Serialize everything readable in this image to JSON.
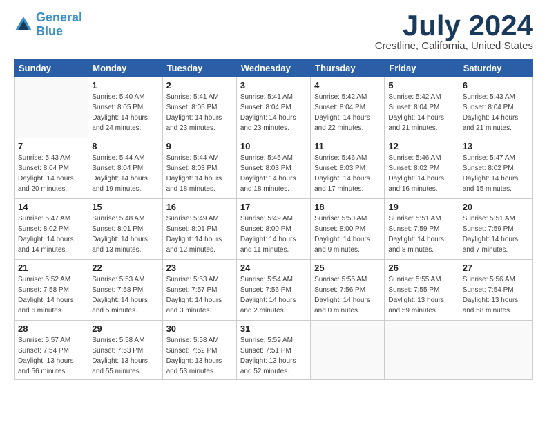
{
  "header": {
    "logo_line1": "General",
    "logo_line2": "Blue",
    "month": "July 2024",
    "location": "Crestline, California, United States"
  },
  "days_of_week": [
    "Sunday",
    "Monday",
    "Tuesday",
    "Wednesday",
    "Thursday",
    "Friday",
    "Saturday"
  ],
  "weeks": [
    [
      {
        "day": "",
        "info": ""
      },
      {
        "day": "1",
        "info": "Sunrise: 5:40 AM\nSunset: 8:05 PM\nDaylight: 14 hours\nand 24 minutes."
      },
      {
        "day": "2",
        "info": "Sunrise: 5:41 AM\nSunset: 8:05 PM\nDaylight: 14 hours\nand 23 minutes."
      },
      {
        "day": "3",
        "info": "Sunrise: 5:41 AM\nSunset: 8:04 PM\nDaylight: 14 hours\nand 23 minutes."
      },
      {
        "day": "4",
        "info": "Sunrise: 5:42 AM\nSunset: 8:04 PM\nDaylight: 14 hours\nand 22 minutes."
      },
      {
        "day": "5",
        "info": "Sunrise: 5:42 AM\nSunset: 8:04 PM\nDaylight: 14 hours\nand 21 minutes."
      },
      {
        "day": "6",
        "info": "Sunrise: 5:43 AM\nSunset: 8:04 PM\nDaylight: 14 hours\nand 21 minutes."
      }
    ],
    [
      {
        "day": "7",
        "info": "Sunrise: 5:43 AM\nSunset: 8:04 PM\nDaylight: 14 hours\nand 20 minutes."
      },
      {
        "day": "8",
        "info": "Sunrise: 5:44 AM\nSunset: 8:04 PM\nDaylight: 14 hours\nand 19 minutes."
      },
      {
        "day": "9",
        "info": "Sunrise: 5:44 AM\nSunset: 8:03 PM\nDaylight: 14 hours\nand 18 minutes."
      },
      {
        "day": "10",
        "info": "Sunrise: 5:45 AM\nSunset: 8:03 PM\nDaylight: 14 hours\nand 18 minutes."
      },
      {
        "day": "11",
        "info": "Sunrise: 5:46 AM\nSunset: 8:03 PM\nDaylight: 14 hours\nand 17 minutes."
      },
      {
        "day": "12",
        "info": "Sunrise: 5:46 AM\nSunset: 8:02 PM\nDaylight: 14 hours\nand 16 minutes."
      },
      {
        "day": "13",
        "info": "Sunrise: 5:47 AM\nSunset: 8:02 PM\nDaylight: 14 hours\nand 15 minutes."
      }
    ],
    [
      {
        "day": "14",
        "info": "Sunrise: 5:47 AM\nSunset: 8:02 PM\nDaylight: 14 hours\nand 14 minutes."
      },
      {
        "day": "15",
        "info": "Sunrise: 5:48 AM\nSunset: 8:01 PM\nDaylight: 14 hours\nand 13 minutes."
      },
      {
        "day": "16",
        "info": "Sunrise: 5:49 AM\nSunset: 8:01 PM\nDaylight: 14 hours\nand 12 minutes."
      },
      {
        "day": "17",
        "info": "Sunrise: 5:49 AM\nSunset: 8:00 PM\nDaylight: 14 hours\nand 11 minutes."
      },
      {
        "day": "18",
        "info": "Sunrise: 5:50 AM\nSunset: 8:00 PM\nDaylight: 14 hours\nand 9 minutes."
      },
      {
        "day": "19",
        "info": "Sunrise: 5:51 AM\nSunset: 7:59 PM\nDaylight: 14 hours\nand 8 minutes."
      },
      {
        "day": "20",
        "info": "Sunrise: 5:51 AM\nSunset: 7:59 PM\nDaylight: 14 hours\nand 7 minutes."
      }
    ],
    [
      {
        "day": "21",
        "info": "Sunrise: 5:52 AM\nSunset: 7:58 PM\nDaylight: 14 hours\nand 6 minutes."
      },
      {
        "day": "22",
        "info": "Sunrise: 5:53 AM\nSunset: 7:58 PM\nDaylight: 14 hours\nand 5 minutes."
      },
      {
        "day": "23",
        "info": "Sunrise: 5:53 AM\nSunset: 7:57 PM\nDaylight: 14 hours\nand 3 minutes."
      },
      {
        "day": "24",
        "info": "Sunrise: 5:54 AM\nSunset: 7:56 PM\nDaylight: 14 hours\nand 2 minutes."
      },
      {
        "day": "25",
        "info": "Sunrise: 5:55 AM\nSunset: 7:56 PM\nDaylight: 14 hours\nand 0 minutes."
      },
      {
        "day": "26",
        "info": "Sunrise: 5:55 AM\nSunset: 7:55 PM\nDaylight: 13 hours\nand 59 minutes."
      },
      {
        "day": "27",
        "info": "Sunrise: 5:56 AM\nSunset: 7:54 PM\nDaylight: 13 hours\nand 58 minutes."
      }
    ],
    [
      {
        "day": "28",
        "info": "Sunrise: 5:57 AM\nSunset: 7:54 PM\nDaylight: 13 hours\nand 56 minutes."
      },
      {
        "day": "29",
        "info": "Sunrise: 5:58 AM\nSunset: 7:53 PM\nDaylight: 13 hours\nand 55 minutes."
      },
      {
        "day": "30",
        "info": "Sunrise: 5:58 AM\nSunset: 7:52 PM\nDaylight: 13 hours\nand 53 minutes."
      },
      {
        "day": "31",
        "info": "Sunrise: 5:59 AM\nSunset: 7:51 PM\nDaylight: 13 hours\nand 52 minutes."
      },
      {
        "day": "",
        "info": ""
      },
      {
        "day": "",
        "info": ""
      },
      {
        "day": "",
        "info": ""
      }
    ]
  ]
}
